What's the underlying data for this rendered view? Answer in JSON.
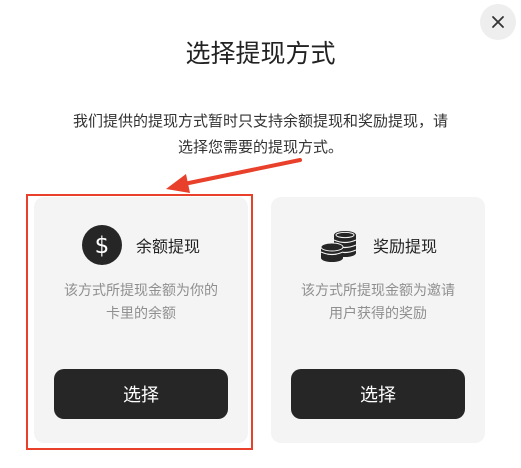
{
  "dialog": {
    "title": "选择提现方式",
    "description_line1": "我们提供的提现方式暂时只支持余额提现和奖励提现，请",
    "description_line2": "选择您需要的提现方式。",
    "close_icon": "close-icon"
  },
  "options": [
    {
      "icon": "dollar-circle-icon",
      "name": "余额提现",
      "desc_line1": "该方式所提现金额为你的",
      "desc_line2": "卡里的余额",
      "button_label": "选择"
    },
    {
      "icon": "coin-stack-icon",
      "name": "奖励提现",
      "desc_line1": "该方式所提现金额为邀请",
      "desc_line2": "用户获得的奖励",
      "button_label": "选择"
    }
  ],
  "annotation": {
    "highlight_color": "#e8402a",
    "highlighted_option": "余额提现"
  },
  "colors": {
    "button_bg": "#262626",
    "card_bg": "#f4f4f4",
    "muted_text": "#8f8f8f"
  }
}
